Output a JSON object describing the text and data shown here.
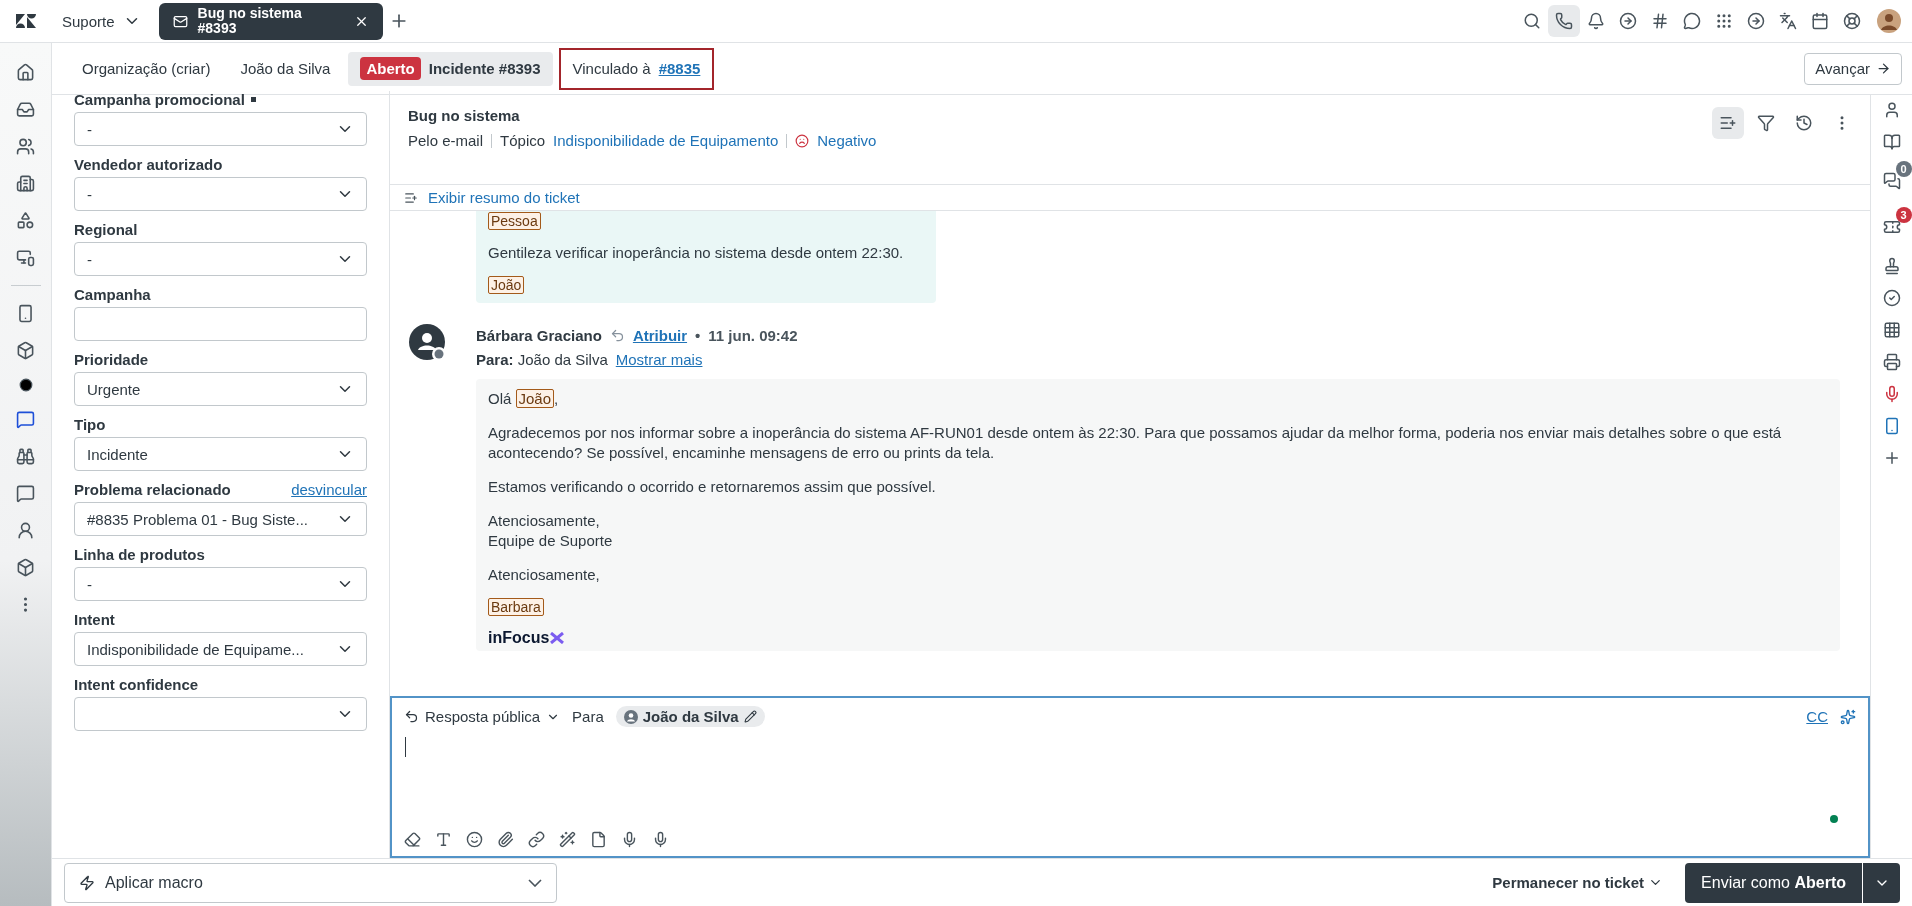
{
  "top_bar": {
    "workspace": "Suporte",
    "tabs": [
      {
        "title": "Bug no sistema",
        "subtitle": "#8393",
        "selected": true
      }
    ]
  },
  "context_bar": {
    "items": [
      {
        "kind": "plain",
        "label": "Organização (criar)",
        "selected": false
      },
      {
        "kind": "plain",
        "label": "João da Silva",
        "selected": false
      },
      {
        "kind": "status",
        "badge": "Aberto",
        "label": "Incidente #8393",
        "selected": true
      },
      {
        "kind": "linked",
        "label": "Vinculado à",
        "link": "#8835",
        "selected": false
      }
    ],
    "next_button": "Avançar"
  },
  "fields": [
    {
      "kind": "select",
      "label": "Campanha promocional",
      "value": "-",
      "required": true
    },
    {
      "kind": "select",
      "label": "Vendedor autorizado",
      "value": "-"
    },
    {
      "kind": "select",
      "label": "Regional",
      "value": "-"
    },
    {
      "kind": "text",
      "label": "Campanha"
    },
    {
      "kind": "select",
      "label": "Prioridade",
      "value": "Urgente"
    },
    {
      "kind": "select",
      "label": "Tipo",
      "value": "Incidente"
    },
    {
      "kind": "select",
      "label": "Problema relacionado",
      "value": "#8835 Problema 01  - Bug Siste...",
      "action": "desvincular"
    },
    {
      "kind": "select",
      "label": "Linha de produtos",
      "value": "-"
    },
    {
      "kind": "select",
      "label": "Intent",
      "value": "Indisponibilidade de Equipame..."
    },
    {
      "kind": "select",
      "label": "Intent confidence"
    }
  ],
  "ticket": {
    "subject": "Bug no sistema",
    "channel": "Pelo e-mail",
    "topic_label": "Tópico",
    "topic": "Indisponibilidade de Equipamento",
    "sentiment": "Negativo",
    "summary_link": "Exibir resumo do ticket"
  },
  "messages": [
    {
      "kind": "incoming",
      "top_tag": "Pessoa",
      "paragraphs": [
        [
          "Gentileza verificar inoperância no sistema desde ontem 22:30."
        ]
      ],
      "signature_tag": "João"
    },
    {
      "kind": "outgoing",
      "author": "Bárbara Graciano",
      "action": "Atribuir",
      "separator": "•",
      "time": "11 jun. 09:42",
      "to_label": "Para:",
      "to": "João da Silva",
      "more": "Mostrar mais",
      "greeting": "Olá",
      "greeting_tag": "João",
      "greeting_end": ",",
      "paragraphs": [
        [
          "Agradecemos por nos informar sobre a inoperância do sistema AF-RUN01 desde ontem às 22:30. Para que possamos ajudar da melhor forma, poderia nos enviar mais detalhes sobre o que está acontecendo? Se possível, encaminhe mensagens de erro ou prints da tela."
        ],
        [
          "Estamos verificando o ocorrido e retornaremos assim que possível."
        ],
        [
          "Atenciosamente,",
          "Equipe de Suporte"
        ],
        [
          "Atenciosamente,"
        ]
      ],
      "signature_tag": "Barbara",
      "logo": "inFocus"
    }
  ],
  "composer": {
    "mode": "Resposta pública",
    "to_label": "Para",
    "recipient": "João da Silva",
    "cc": "CC"
  },
  "footer": {
    "macro_placeholder": "Aplicar macro",
    "stay": "Permanecer no ticket",
    "submit_prefix": "Enviar como",
    "submit_status": "Aberto"
  },
  "right_rail": {
    "conversations_count": "0",
    "tickets_count": "3"
  }
}
